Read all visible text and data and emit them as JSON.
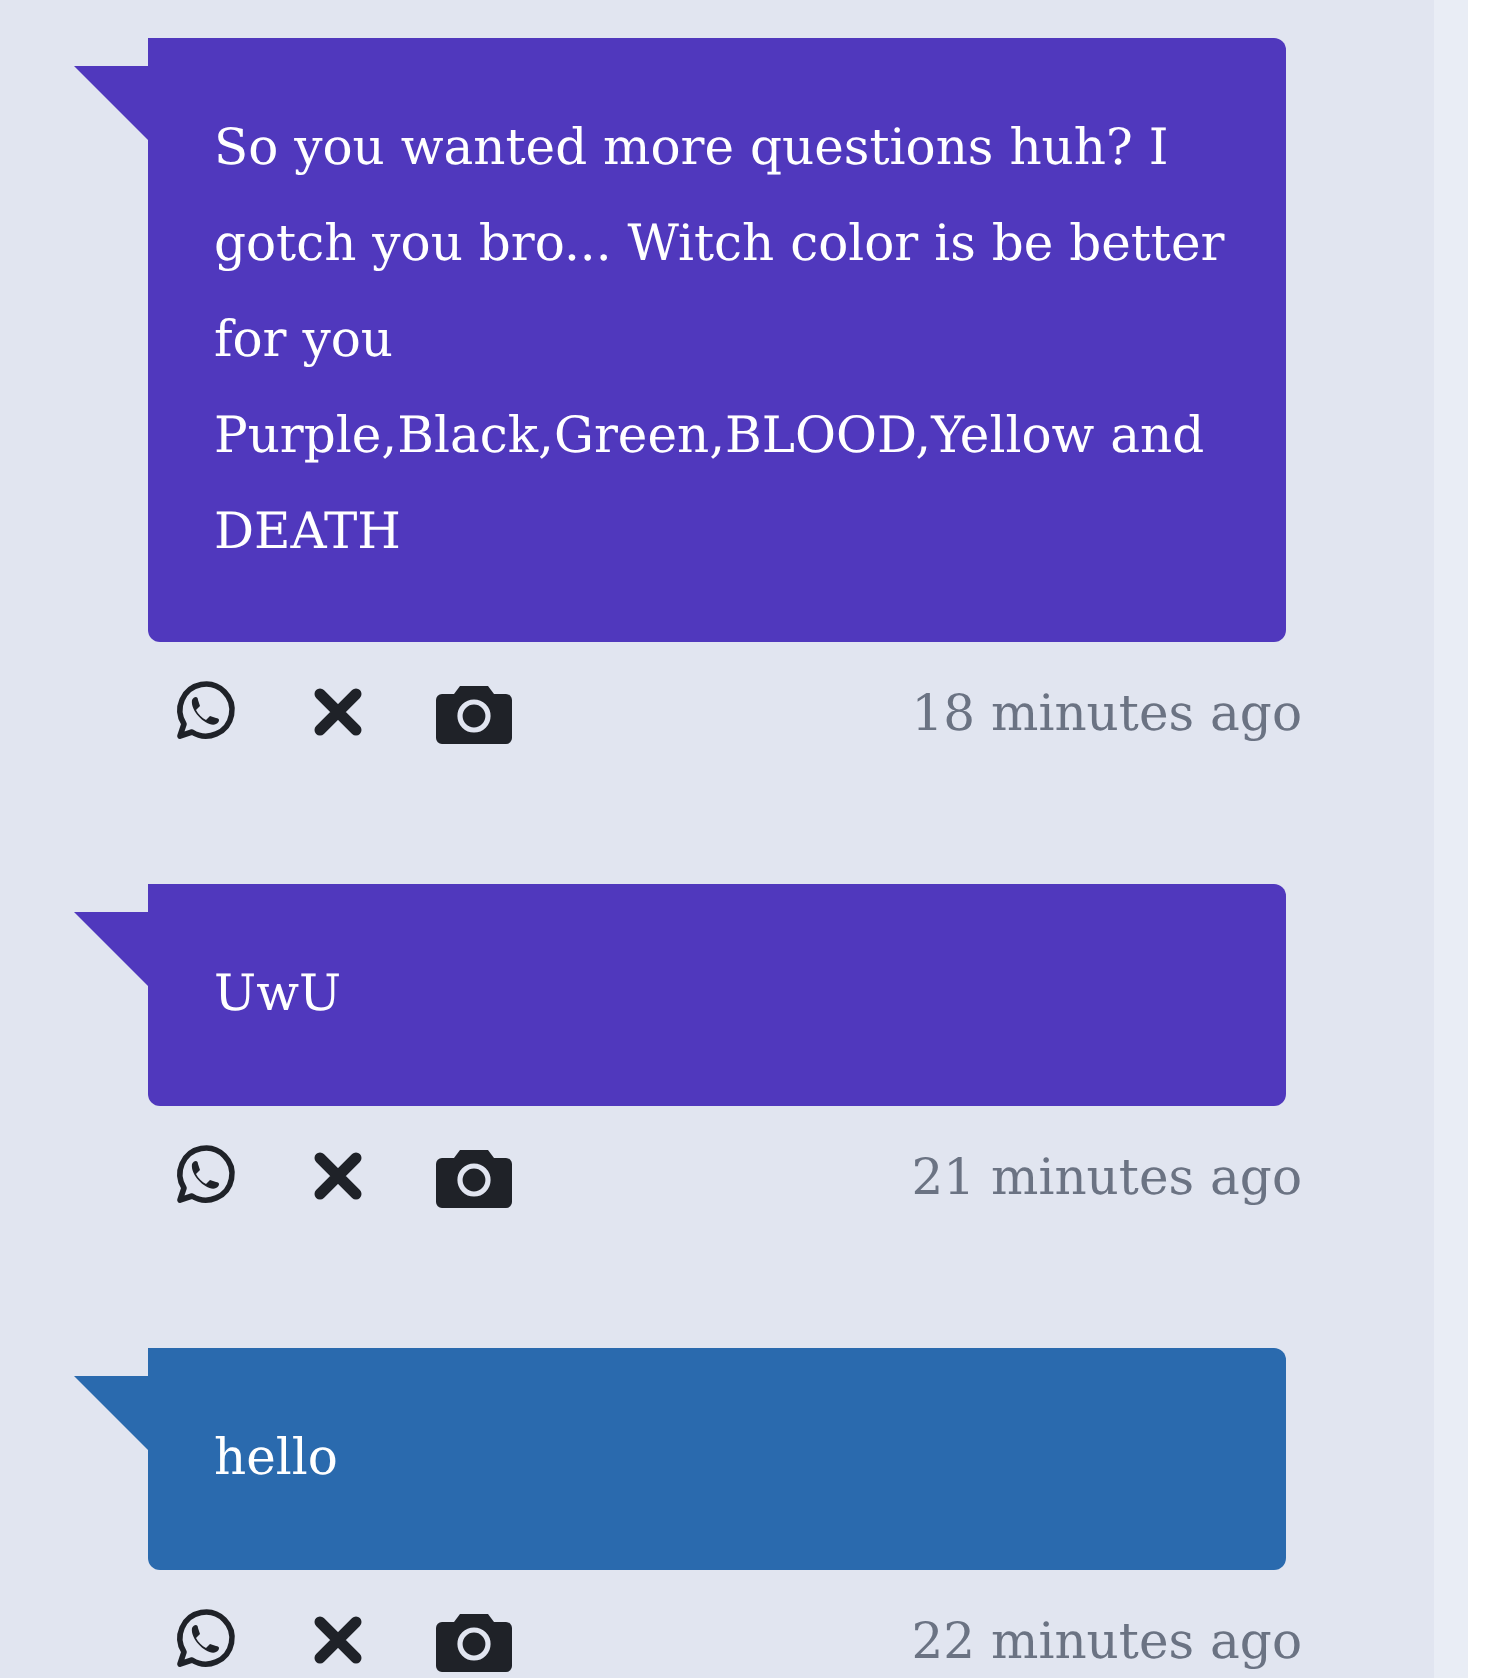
{
  "messages": [
    {
      "text": "So you wanted more questions huh? I gotch you bro... Witch color is be better for you Purple,Black,Green,BLOOD,Yellow and DEATH",
      "color": "#5038bd",
      "time": "18 minutes ago"
    },
    {
      "text": "UwU",
      "color": "#5038bd",
      "time": "21 minutes ago"
    },
    {
      "text": "hello",
      "color": "#2a6aae",
      "time": "22 minutes ago"
    }
  ]
}
